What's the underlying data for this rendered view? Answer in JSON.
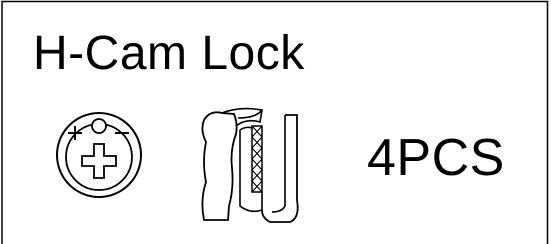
{
  "label": {
    "title": "H-Cam Lock",
    "quantity": "4PCS"
  },
  "icons": {
    "cam_lock_disc": "cam-lock-disc-icon",
    "cam_lock_bolt": "cam-lock-bolt-icon"
  },
  "colors": {
    "ink": "#000000",
    "background": "#ffffff"
  }
}
